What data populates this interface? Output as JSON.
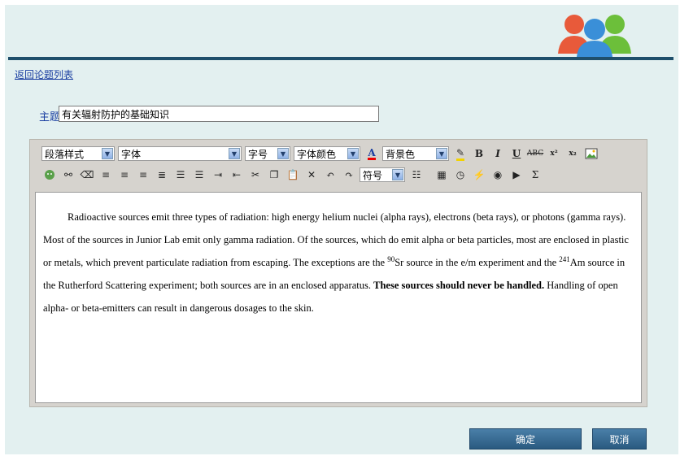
{
  "nav": {
    "back_label": "返回论题列表"
  },
  "subject": {
    "label": "主题",
    "value": "有关辐射防护的基础知识"
  },
  "toolbar": {
    "paragraph_style": "段落样式",
    "font": "字体",
    "font_size": "字号",
    "font_color": "字体颜色",
    "background_color": "背景色",
    "symbols": "符号",
    "bold": "B",
    "italic": "I",
    "underline": "U",
    "strike": "ABC",
    "superscript": "x²",
    "subscript": "x₂"
  },
  "content": {
    "p1": "Radioactive sources emit three types of radiation: high energy helium nuclei (alpha rays), electrons (beta rays), or photons (gamma rays). Most of the sources in Junior Lab emit only gamma radiation. Of the sources, which do emit alpha or beta particles, most are enclosed in plastic or metals, which prevent particulate radiation from escaping. The exceptions are the ",
    "sup1": "90",
    "p2": "Sr source in the e/m experiment and the ",
    "sup2": "241",
    "p3": "Am source in the Rutherford Scattering experiment; both sources are in an enclosed apparatus. ",
    "bold": "These sources should never be handled.",
    "p4": " Handling of open alpha- or beta-emitters can result in dangerous dosages to the skin."
  },
  "buttons": {
    "ok": "确定",
    "cancel": "取消"
  },
  "colors": {
    "page_bg": "#e3f0f0",
    "header_bar": "#1f4f6b",
    "link": "#1a3ea1",
    "button": "#3a6d96",
    "editor_bg": "#d6d3ce"
  }
}
